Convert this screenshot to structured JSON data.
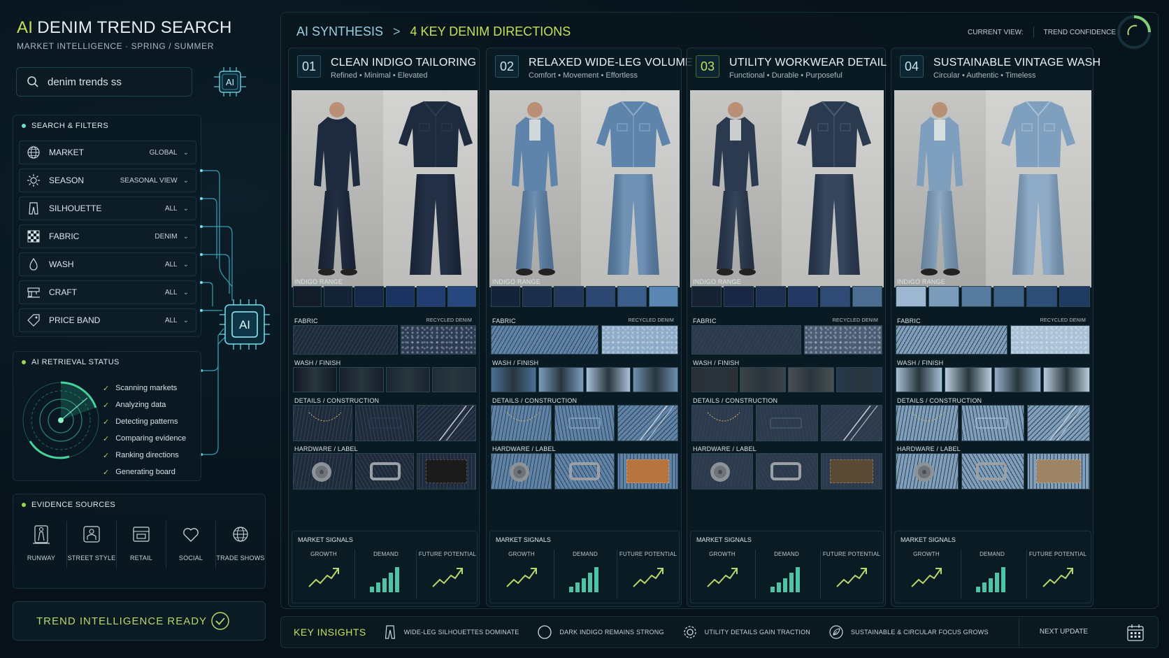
{
  "brand": {
    "ai": "AI",
    "title": "DENIM TREND SEARCH",
    "subtitle": "MARKET INTELLIGENCE · SPRING / SUMMER"
  },
  "search": {
    "value": "denim trends ss",
    "chip": "AI"
  },
  "filters": {
    "title": "SEARCH & FILTERS",
    "items": [
      {
        "label": "MARKET",
        "value": "GLOBAL",
        "icon": "globe-icon"
      },
      {
        "label": "SEASON",
        "value": "SEASONAL VIEW",
        "icon": "sun-icon"
      },
      {
        "label": "SILHOUETTE",
        "value": "ALL",
        "icon": "trousers-icon"
      },
      {
        "label": "FABRIC",
        "value": "DENIM",
        "icon": "fabric-icon"
      },
      {
        "label": "WASH",
        "value": "ALL",
        "icon": "drop-icon"
      },
      {
        "label": "CRAFT",
        "value": "ALL",
        "icon": "machine-icon"
      },
      {
        "label": "PRICE BAND",
        "value": "ALL",
        "icon": "tag-icon"
      }
    ]
  },
  "ai_chip_center": "AI",
  "retrieval": {
    "title": "AI RETRIEVAL STATUS",
    "items": [
      "Scanning markets",
      "Analyzing data",
      "Detecting patterns",
      "Comparing evidence",
      "Ranking directions",
      "Generating board"
    ]
  },
  "sources": {
    "title": "EVIDENCE SOURCES",
    "items": [
      {
        "label": "RUNWAY",
        "icon": "runway-icon"
      },
      {
        "label": "STREET STYLE",
        "icon": "street-style-icon"
      },
      {
        "label": "RETAIL",
        "icon": "retail-icon"
      },
      {
        "label": "SOCIAL",
        "icon": "social-icon"
      },
      {
        "label": "TRADE SHOWS",
        "icon": "trade-shows-icon"
      }
    ]
  },
  "ready": "TREND INTELLIGENCE READY",
  "header": {
    "crumb1": "AI SYNTHESIS",
    "sep": ">",
    "crumb2": "4 KEY DENIM DIRECTIONS",
    "current_view": "CURRENT VIEW:",
    "confidence": "TREND CONFIDENCE"
  },
  "labels": {
    "indigo": "INDIGO RANGE",
    "fabric": "FABRIC",
    "recycled": "RECYCLED DENIM",
    "wash": "WASH / FINISH",
    "details": "DETAILS / CONSTRUCTION",
    "hardware": "HARDWARE / LABEL",
    "signals": "MARKET SIGNALS",
    "growth": "GROWTH",
    "demand": "DEMAND",
    "future": "FUTURE POTENTIAL"
  },
  "directions": [
    {
      "num": "01",
      "title": "CLEAN INDIGO TAILORING",
      "sub": "Refined • Minimal • Elevated",
      "indigo": [
        "#111c28",
        "#142236",
        "#17294a",
        "#1c3461",
        "#213d72",
        "#27477f"
      ],
      "wash": [
        "#111a24",
        "#151f2b",
        "#1a2532",
        "#212d3b"
      ],
      "tone": "#1e2a3e",
      "light": "#2d3c55",
      "leather": "#1b1b1b"
    },
    {
      "num": "02",
      "title": "RELAXED WIDE-LEG VOLUME",
      "sub": "Comfort • Movement • Effortless",
      "indigo": [
        "#152338",
        "#1d2e4a",
        "#23375b",
        "#2b4772",
        "#3a5d8b",
        "#5a86b4"
      ],
      "wash": [
        "#4b6f96",
        "#7b9cbd",
        "#a9c0d6",
        "#6e8fb0"
      ],
      "tone": "#5f84ab",
      "light": "#8eabc8",
      "leather": "#b8743f"
    },
    {
      "num": "03",
      "title": "UTILITY WORKWEAR DETAIL",
      "sub": "Functional • Durable • Purposeful",
      "indigo": [
        "#162132",
        "#192744",
        "#1d3052",
        "#233862",
        "#2f4a74",
        "#4c6d92"
      ],
      "wash": [
        "#2a2f33",
        "#3d4246",
        "#4a4f52",
        "#26384d"
      ],
      "tone": "#2c3a50",
      "light": "#4a5d75",
      "leather": "#5a4a33"
    },
    {
      "num": "04",
      "title": "SUSTAINABLE VINTAGE WASH",
      "sub": "Circular • Authentic • Timeless",
      "indigo": [
        "#9cb7cf",
        "#7a9bba",
        "#587ca0",
        "#3f6288",
        "#2d4e76",
        "#1f3b61"
      ],
      "wash": [
        "#a6bed3",
        "#bacddd",
        "#94aec6",
        "#b9cbdb"
      ],
      "tone": "#7f9fbe",
      "light": "#aac1d6",
      "leather": "#9e8466"
    }
  ],
  "insights": {
    "title": "KEY INSIGHTS",
    "items": [
      {
        "text": "WIDE-LEG SILHOUETTES DOMINATE",
        "icon": "trousers-icon"
      },
      {
        "text": "DARK INDIGO REMAINS STRONG",
        "icon": "circle-icon"
      },
      {
        "text": "UTILITY DETAILS GAIN TRACTION",
        "icon": "gear-icon"
      },
      {
        "text": "SUSTAINABLE & CIRCULAR FOCUS GROWS",
        "icon": "leaf-icon"
      }
    ],
    "next": "NEXT UPDATE"
  },
  "colors": {
    "accent": "#c4e05a",
    "cyan": "#6ee0c8",
    "teal": "#4fc3a6"
  }
}
